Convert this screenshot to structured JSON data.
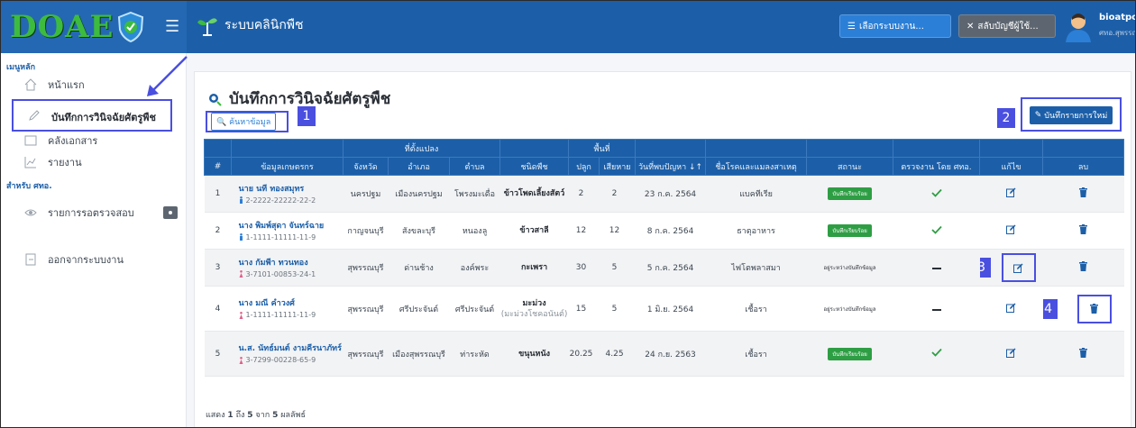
{
  "header": {
    "brand": "DOAE",
    "system_title": "ระบบคลินิกพืช",
    "select_system_label": "เลือกระบบงาน...",
    "switch_account_label": "สลับบัญชีผู้ใช้...",
    "user_name": "bioatpc",
    "user_sub": "ศทอ.สุพรรณบุรี"
  },
  "sidebar": {
    "main_heading": "เมนูหลัก",
    "items": [
      {
        "label": "หน้าแรก",
        "icon": "home-icon"
      },
      {
        "label": "บันทึกการวินิจฉัยศัตรูพืช",
        "icon": "pencil-icon"
      },
      {
        "label": "คลังเอกสาร",
        "icon": "folder-icon"
      },
      {
        "label": "รายงาน",
        "icon": "chart-icon"
      }
    ],
    "section_heading": "สำหรับ ศทอ.",
    "review_label": "รายการรอตรวจสอบ",
    "logout_label": "ออกจากระบบงาน"
  },
  "main": {
    "title": "บันทึกการวินิจฉัยศัตรูพืช",
    "search_button": "ค้นหาข้อมูล",
    "new_button": "บันทึกรายการใหม่",
    "callouts": [
      "1",
      "2",
      "3",
      "4"
    ],
    "group_headers": {
      "location": "ที่ตั้งแปลง",
      "area": "พื้นที่"
    },
    "columns": [
      "#",
      "ข้อมูลเกษตรกร",
      "จังหวัด",
      "อำเภอ",
      "ตำบล",
      "ชนิดพืช",
      "ปลูก",
      "เสียหาย",
      "วันที่พบปัญหา ↓↑",
      "ชื่อโรคและแมลงสาเหตุ",
      "สถานะ",
      "ตรวจงาน โดย ศทอ.",
      "แก้ไข",
      "ลบ"
    ],
    "rows": [
      {
        "no": "1",
        "name": "นาย นที ทองสมุทร",
        "id": "2-2222-22222-22-2",
        "gender": "male",
        "province": "นครปฐม",
        "district": "เมืองนครปฐม",
        "subdistrict": "โพรงมะเดื่อ",
        "plant": "ข้าวโพดเลี้ยงสัตว์",
        "plant_sub": "",
        "planted": "2",
        "damaged": "2",
        "date": "23 ก.ค. 2564",
        "cause": "แบคทีเรีย",
        "status": "บันทึกเรียบร้อย",
        "status_kind": "done",
        "checked": true
      },
      {
        "no": "2",
        "name": "นาง พิมพ์สุดา จันทร์ฉาย",
        "id": "1-1111-11111-11-9",
        "gender": "male",
        "province": "กาญจนบุรี",
        "district": "สังขละบุรี",
        "subdistrict": "หนองลู",
        "plant": "ข้าวสาลี",
        "plant_sub": "",
        "planted": "12",
        "damaged": "12",
        "date": "8 ก.ค. 2564",
        "cause": "ธาตุอาหาร",
        "status": "บันทึกเรียบร้อย",
        "status_kind": "done",
        "checked": true
      },
      {
        "no": "3",
        "name": "นาง กัมพีา ทวนทอง",
        "id": "3-7101-00853-24-1",
        "gender": "female",
        "province": "สุพรรณบุรี",
        "district": "ด่านช้าง",
        "subdistrict": "องค์พระ",
        "plant": "กะเพรา",
        "plant_sub": "",
        "planted": "30",
        "damaged": "5",
        "date": "5 ก.ค. 2564",
        "cause": "ไฟโตพลาสมา",
        "status": "อยู่ระหว่างบันทึกข้อมูล",
        "status_kind": "pending",
        "checked": false
      },
      {
        "no": "4",
        "name": "นาง มณี คำวงศ์",
        "id": "1-1111-11111-11-9",
        "gender": "female",
        "province": "สุพรรณบุรี",
        "district": "ศรีประจันต์",
        "subdistrict": "ศรีประจันต์",
        "plant": "มะม่วง",
        "plant_sub": "(มะม่วงโชคอนันต์)",
        "planted": "15",
        "damaged": "5",
        "date": "1 มิ.ย. 2564",
        "cause": "เชื้อรา",
        "status": "อยู่ระหว่างบันทึกข้อมูล",
        "status_kind": "pending",
        "checked": false
      },
      {
        "no": "5",
        "name": "น.ส. นัทธ์มนต์ งามคีรนาภัทร์",
        "id": "3-7299-00228-65-9",
        "gender": "female",
        "province": "สุพรรณบุรี",
        "district": "เมืองสุพรรณบุรี",
        "subdistrict": "ท่าระหัด",
        "plant": "ขนุนหนัง",
        "plant_sub": "",
        "planted": "20.25",
        "damaged": "4.25",
        "date": "24 ก.ย. 2563",
        "cause": "เชื้อรา",
        "status": "บันทึกเรียบร้อย",
        "status_kind": "done",
        "checked": true
      }
    ],
    "footer": {
      "prefix": "แสดง",
      "from": "1",
      "to_word": "ถึง",
      "to": "5",
      "of_word": "จาก",
      "total": "5",
      "suffix": "ผลลัพธ์"
    }
  },
  "colors": {
    "navbar": "#1c5fa8",
    "brand_green": "#3dbb3f",
    "highlight": "#4a4fe0",
    "status_done": "#2e9e44",
    "check": "#2e9e44",
    "male_icon": "#2c7fd6",
    "female_icon": "#e0608a"
  }
}
